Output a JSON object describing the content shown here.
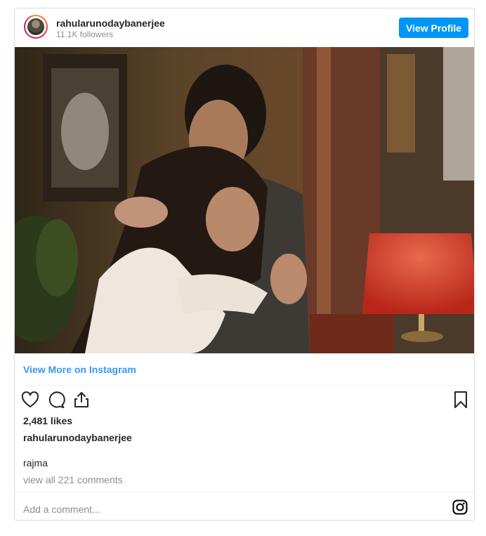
{
  "header": {
    "username": "rahularunodaybanerjee",
    "followers": "11.1K followers",
    "view_profile_label": "View Profile"
  },
  "post": {
    "view_more_label": "View More on Instagram",
    "likes": "2,481 likes",
    "caption_username": "rahularunodaybanerjee",
    "caption": "rajma",
    "view_comments": "view all 221 comments"
  },
  "comment_box": {
    "placeholder": "Add a comment..."
  },
  "icons": {
    "like": "heart-icon",
    "comment": "comment-bubble-icon",
    "share": "share-icon",
    "save": "bookmark-icon",
    "instagram": "instagram-logo-icon"
  },
  "colors": {
    "primary_button": "#0095f6",
    "link": "#3897f0",
    "secondary_text": "#8e8e8e"
  }
}
